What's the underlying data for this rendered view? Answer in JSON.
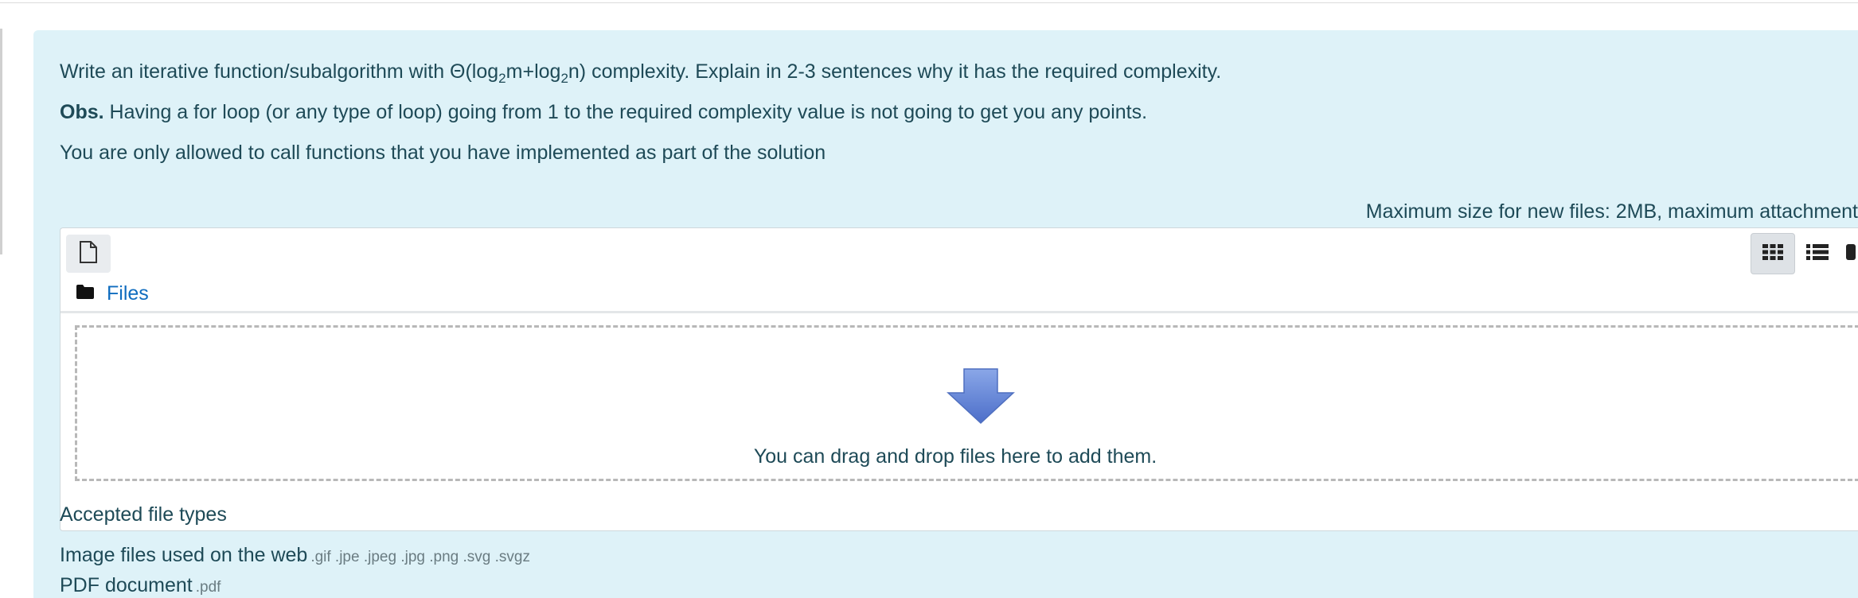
{
  "question": {
    "line1_pre": "Write an iterative function/subalgorithm with Θ(log",
    "line1_sub1": "2",
    "line1_mid": "m+log",
    "line1_sub2": "2",
    "line1_post": "n) complexity. Explain in 2-3 sentences why it has the required complexity.",
    "obs_label": "Obs.",
    "obs_text": " Having a for loop (or any type of loop) going from 1 to the required complexity value is not going to get you any points.",
    "line3": "You are only allowed to call functions that you have implemented as part of the solution"
  },
  "filemanager": {
    "max_size_text": "Maximum size for new files: 2MB, maximum attachment",
    "add_file_icon": "file-icon",
    "view_icons": [
      "grid-icon",
      "list-icon",
      "tree-icon"
    ],
    "path_icon": "folder-icon",
    "path_label": "Files",
    "drop_icon": "down-arrow-icon",
    "drop_text": "You can drag and drop files here to add them."
  },
  "accepted": {
    "title": "Accepted file types",
    "types": [
      {
        "name": "Image files used on the web",
        "ext": ".gif .jpe .jpeg .jpg .png .svg .svgz"
      },
      {
        "name": "PDF document",
        "ext": ".pdf"
      }
    ]
  },
  "colors": {
    "panel_bg": "#def2f8",
    "text": "#1e4a57",
    "link": "#0f6cbf",
    "arrow": "#5b7fd4"
  }
}
